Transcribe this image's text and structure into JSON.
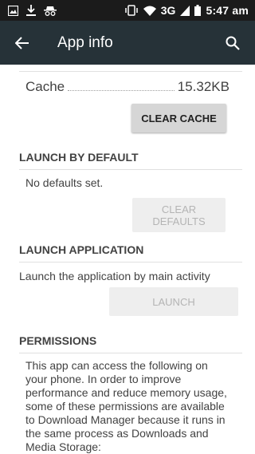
{
  "status_bar": {
    "left_icons": [
      "image-icon",
      "download-icon",
      "incognito-icon"
    ],
    "network": "3G",
    "time": "5:47 am",
    "right_icons": [
      "vibrate-icon",
      "wifi-icon",
      "signal-icon",
      "battery-icon"
    ]
  },
  "app_bar": {
    "title": "App info",
    "back_icon": "arrow-back-icon",
    "search_icon": "search-icon",
    "color": "#263238"
  },
  "storage": {
    "cache_label": "Cache",
    "cache_value": "15.32KB",
    "clear_cache_button": "CLEAR CACHE"
  },
  "launch_by_default": {
    "header": "LAUNCH BY DEFAULT",
    "description": "No defaults set.",
    "clear_defaults_button_line1": "CLEAR",
    "clear_defaults_button_line2": "DEFAULTS"
  },
  "launch_application": {
    "header": "LAUNCH APPLICATION",
    "description": "Launch the application by main activity",
    "launch_button": "LAUNCH"
  },
  "permissions": {
    "header": "PERMISSIONS",
    "description": "This app can access the following on your phone. In order to improve performance and reduce memory usage, some of these permissions are available to Download Manager because it runs in the same process as Downloads and Media Storage:"
  }
}
